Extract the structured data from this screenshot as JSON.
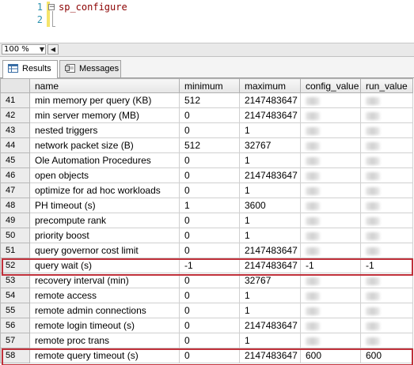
{
  "editor": {
    "line_numbers": [
      "1",
      "2"
    ],
    "code": "sp_configure"
  },
  "zoom": {
    "level": "100 %"
  },
  "tabs": [
    {
      "label": "Results",
      "icon": "grid-icon"
    },
    {
      "label": "Messages",
      "icon": "messages-icon"
    }
  ],
  "grid": {
    "columns": [
      "name",
      "minimum",
      "maximum",
      "config_value",
      "run_value"
    ],
    "rows": [
      {
        "n": "41",
        "name": "min memory per query (KB)",
        "minimum": "512",
        "maximum": "2147483647",
        "config_value": "",
        "run_value": ""
      },
      {
        "n": "42",
        "name": "min server memory (MB)",
        "minimum": "0",
        "maximum": "2147483647",
        "config_value": "",
        "run_value": ""
      },
      {
        "n": "43",
        "name": "nested triggers",
        "minimum": "0",
        "maximum": "1",
        "config_value": "",
        "run_value": ""
      },
      {
        "n": "44",
        "name": "network packet size (B)",
        "minimum": "512",
        "maximum": "32767",
        "config_value": "",
        "run_value": ""
      },
      {
        "n": "45",
        "name": "Ole Automation Procedures",
        "minimum": "0",
        "maximum": "1",
        "config_value": "",
        "run_value": ""
      },
      {
        "n": "46",
        "name": "open objects",
        "minimum": "0",
        "maximum": "2147483647",
        "config_value": "",
        "run_value": ""
      },
      {
        "n": "47",
        "name": "optimize for ad hoc workloads",
        "minimum": "0",
        "maximum": "1",
        "config_value": "",
        "run_value": ""
      },
      {
        "n": "48",
        "name": "PH timeout (s)",
        "minimum": "1",
        "maximum": "3600",
        "config_value": "",
        "run_value": ""
      },
      {
        "n": "49",
        "name": "precompute rank",
        "minimum": "0",
        "maximum": "1",
        "config_value": "",
        "run_value": ""
      },
      {
        "n": "50",
        "name": "priority boost",
        "minimum": "0",
        "maximum": "1",
        "config_value": "",
        "run_value": ""
      },
      {
        "n": "51",
        "name": "query governor cost limit",
        "minimum": "0",
        "maximum": "2147483647",
        "config_value": "",
        "run_value": ""
      },
      {
        "n": "52",
        "name": "query wait (s)",
        "minimum": "-1",
        "maximum": "2147483647",
        "config_value": "-1",
        "run_value": "-1"
      },
      {
        "n": "53",
        "name": "recovery interval (min)",
        "minimum": "0",
        "maximum": "32767",
        "config_value": "",
        "run_value": ""
      },
      {
        "n": "54",
        "name": "remote access",
        "minimum": "0",
        "maximum": "1",
        "config_value": "",
        "run_value": ""
      },
      {
        "n": "55",
        "name": "remote admin connections",
        "minimum": "0",
        "maximum": "1",
        "config_value": "",
        "run_value": ""
      },
      {
        "n": "56",
        "name": "remote login timeout (s)",
        "minimum": "0",
        "maximum": "2147483647",
        "config_value": "",
        "run_value": ""
      },
      {
        "n": "57",
        "name": "remote proc trans",
        "minimum": "0",
        "maximum": "1",
        "config_value": "",
        "run_value": ""
      },
      {
        "n": "58",
        "name": "remote query timeout (s)",
        "minimum": "0",
        "maximum": "2147483647",
        "config_value": "600",
        "run_value": "600"
      }
    ]
  },
  "highlight_color": "#c0303a"
}
